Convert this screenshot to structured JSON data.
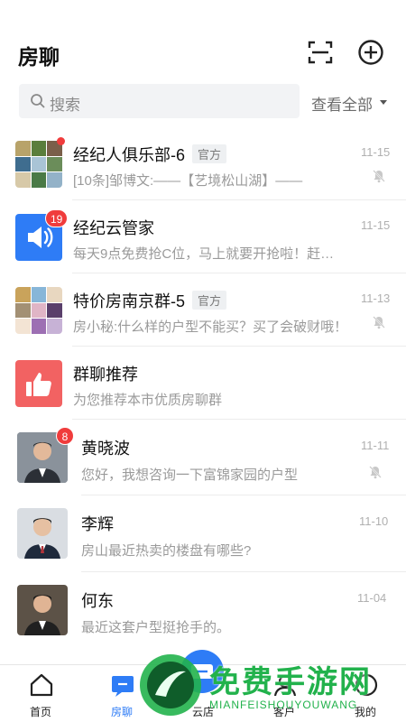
{
  "header": {
    "title": "房聊",
    "scan_icon": "scan-icon",
    "add_icon": "plus-circle-icon"
  },
  "search": {
    "placeholder": "搜索",
    "view_all": "查看全部"
  },
  "conversations": [
    {
      "name": "经纪人俱乐部-6",
      "tag": "官方",
      "message": "[10条]邹博文:——【艺境松山湖】——",
      "time": "11-15",
      "muted": true,
      "unread_dot": true
    },
    {
      "name": "经纪云管家",
      "message": "每天9点免费抢C位，马上就要开抢啦！赶…",
      "time": "11-15",
      "badge": "19"
    },
    {
      "name": "特价房南京群-5",
      "tag": "官方",
      "message": "房小秘:什么样的户型不能买？买了会破财哦！",
      "time": "11-13",
      "muted": true
    },
    {
      "name": "群聊推荐",
      "message": "为您推荐本市优质房聊群"
    },
    {
      "name": "黄晓波",
      "message": "您好，我想咨询一下富锦家园的户型",
      "time": "11-11",
      "muted": true,
      "badge": "8"
    },
    {
      "name": "李辉",
      "message": "房山最近热卖的楼盘有哪些?",
      "time": "11-10"
    },
    {
      "name": "何东",
      "message": "最近这套户型挺抢手的。",
      "time": "11-04"
    }
  ],
  "tabs": [
    {
      "label": "首页",
      "icon": "home-icon"
    },
    {
      "label": "房聊",
      "icon": "chat-icon",
      "active": true
    },
    {
      "label": "云店",
      "icon": "store-icon"
    },
    {
      "label": "客户",
      "icon": "customer-icon"
    },
    {
      "label": "我的",
      "icon": "profile-icon"
    }
  ],
  "watermark": {
    "title": "免费手游网",
    "subtitle": "MIANFEISHOUYOUWANG"
  },
  "colors": {
    "accent": "#2e7cf6",
    "badge": "#f03c3c",
    "recommend": "#f26262",
    "watermark": "#22b24c"
  }
}
